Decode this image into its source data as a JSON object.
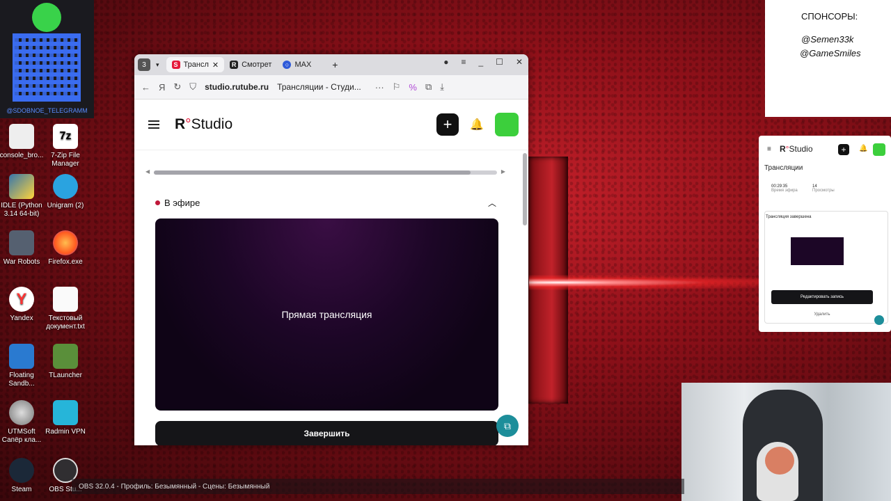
{
  "desktop": {
    "qr_label": "@SDOBNOE_TELEGRAMM",
    "icons": [
      {
        "label": "console_bro..."
      },
      {
        "label": "7-Zip File Manager"
      },
      {
        "label": "IDLE (Python 3.14 64-bit)"
      },
      {
        "label": "Unigram (2)"
      },
      {
        "label": "War Robots"
      },
      {
        "label": "Firefox.exe"
      },
      {
        "label": "Yandex"
      },
      {
        "label": "Текстовый документ.txt"
      },
      {
        "label": "Floating Sandb..."
      },
      {
        "label": "TLauncher"
      },
      {
        "label": "UTMSoft Сапёр кла..."
      },
      {
        "label": "Radmin VPN"
      },
      {
        "label": "Steam"
      },
      {
        "label": "OBS Stu..."
      }
    ]
  },
  "browser": {
    "tab_count": "3",
    "tabs": [
      {
        "label": "Трансл",
        "favicon": "S",
        "color": "#e5193a"
      },
      {
        "label": "Смотрет",
        "favicon": "R",
        "color": "#222222"
      },
      {
        "label": "MAX",
        "favicon": "○",
        "color": "#2f5bd9"
      }
    ],
    "url": "studio.rutube.ru",
    "page_title": "Трансляции - Студи...",
    "more": "···"
  },
  "site": {
    "logo_r": "R",
    "logo_text": "Studio",
    "section_title": "В эфире",
    "player_text": "Прямая трансляция",
    "finish_button": "Завершить"
  },
  "sponsors": {
    "title": "СПОНСОРЫ:",
    "names": [
      "@Semen33k",
      "@GameSmiles"
    ]
  },
  "preview": {
    "title": "Трансляции",
    "stat_time": "00:29:35",
    "stat_time_label": "Время эфира",
    "stat_count": "14",
    "stat_count_label": "Просмотры",
    "card_title": "Трансляция завершена",
    "edit_button": "Редактировать запись",
    "delete": "Удалить"
  },
  "obs": {
    "title": "OBS 32.0.4 - Профиль: Безымянный - Сцены: Безымянный"
  }
}
